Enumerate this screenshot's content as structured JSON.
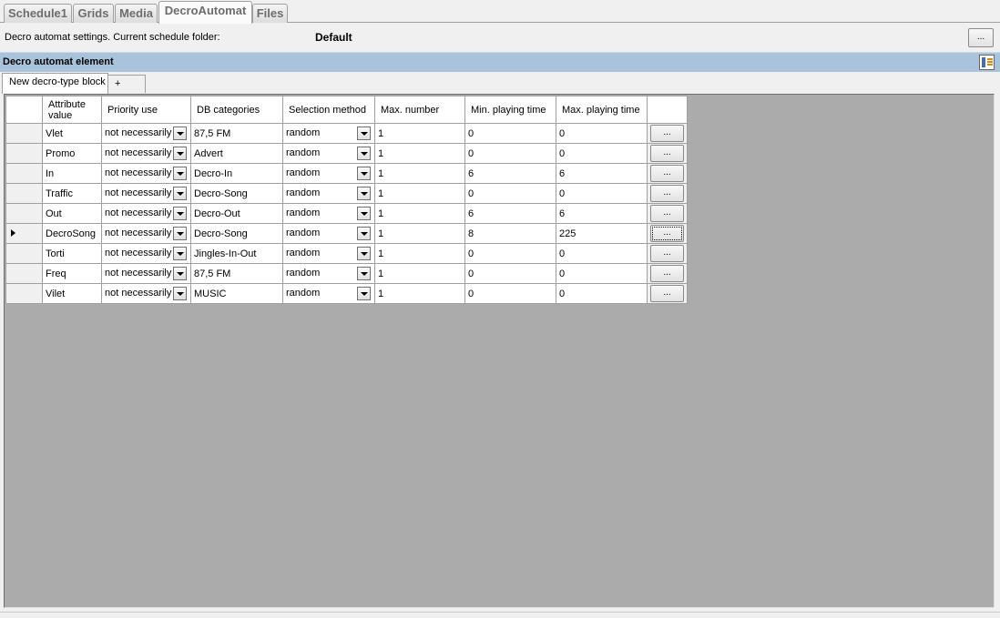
{
  "top_tabs": [
    {
      "label": "Schedule1",
      "active": false
    },
    {
      "label": "Grids",
      "active": false
    },
    {
      "label": "Media",
      "active": false
    },
    {
      "label": "DecroAutomat",
      "active": true
    },
    {
      "label": "Files",
      "active": false
    }
  ],
  "settings": {
    "label": "Decro automat settings. Current schedule folder:",
    "folder_value": "Default",
    "browse_label": "..."
  },
  "section": {
    "title": "Decro automat element",
    "icon": "list-settings-icon"
  },
  "sub_tabs": [
    {
      "label": "New decro-type block",
      "active": true
    },
    {
      "label": "+",
      "active": false
    }
  ],
  "grid": {
    "headers": {
      "attribute_value": "Attribute value",
      "priority_use": "Priority use",
      "db_categories": "DB categories",
      "selection_method": "Selection method",
      "max_number": "Max. number",
      "min_playing_time": "Min. playing time",
      "max_playing_time": "Max. playing time"
    },
    "button_label": "...",
    "current_row": 5,
    "rows": [
      {
        "attribute": "Vlet",
        "priority": "not necessarily",
        "category": "87,5 FM",
        "method": "random",
        "max_number": "1",
        "min_time": "0",
        "max_time": "0"
      },
      {
        "attribute": "Promo",
        "priority": "not necessarily",
        "category": "Advert",
        "method": "random",
        "max_number": "1",
        "min_time": "0",
        "max_time": "0"
      },
      {
        "attribute": "In",
        "priority": "not necessarily",
        "category": "Decro-In",
        "method": "random",
        "max_number": "1",
        "min_time": "6",
        "max_time": "6"
      },
      {
        "attribute": "Traffic",
        "priority": "not necessarily",
        "category": "Decro-Song",
        "method": "random",
        "max_number": "1",
        "min_time": "0",
        "max_time": "0"
      },
      {
        "attribute": "Out",
        "priority": "not necessarily",
        "category": "Decro-Out",
        "method": "random",
        "max_number": "1",
        "min_time": "6",
        "max_time": "6"
      },
      {
        "attribute": "DecroSong",
        "priority": "not necessarily",
        "category": "Decro-Song",
        "method": "random",
        "max_number": "1",
        "min_time": "8",
        "max_time": "225"
      },
      {
        "attribute": "Torti",
        "priority": "not necessarily",
        "category": "Jingles-In-Out",
        "method": "random",
        "max_number": "1",
        "min_time": "0",
        "max_time": "0"
      },
      {
        "attribute": "Freq",
        "priority": "not necessarily",
        "category": "87,5 FM",
        "method": "random",
        "max_number": "1",
        "min_time": "0",
        "max_time": "0"
      },
      {
        "attribute": "Vilet",
        "priority": "not necessarily",
        "category": "MUSIC",
        "method": "random",
        "max_number": "1",
        "min_time": "0",
        "max_time": "0"
      }
    ]
  }
}
